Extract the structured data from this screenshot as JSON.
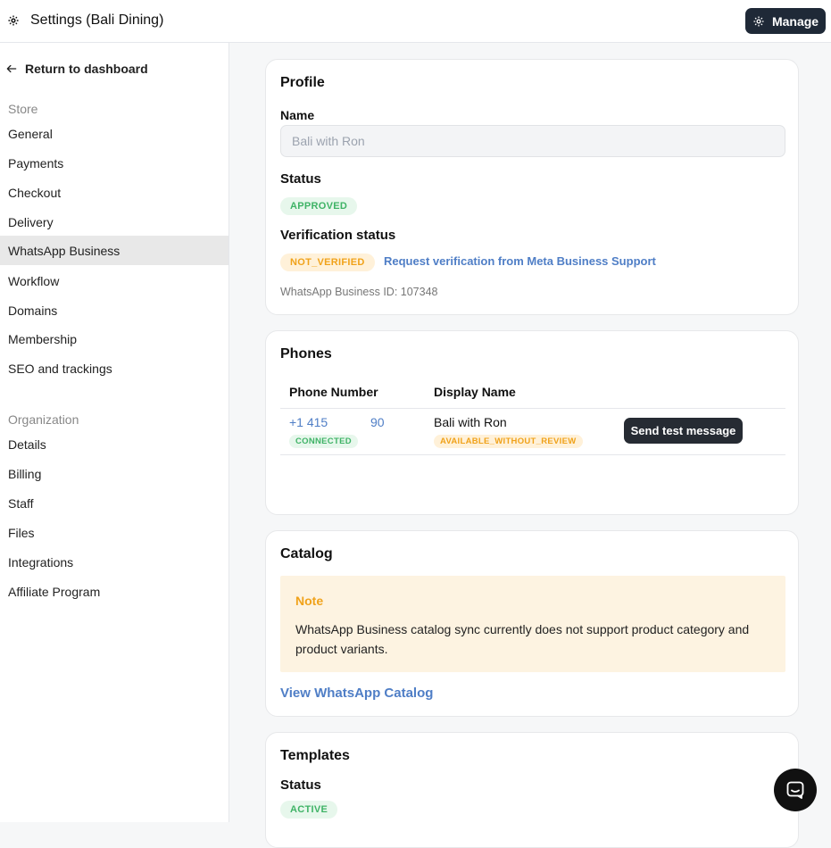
{
  "header": {
    "title": "Settings (Bali Dining)",
    "manage_label": "Manage"
  },
  "sidebar": {
    "return_label": "Return to dashboard",
    "store_label": "Store",
    "store_items": [
      "General",
      "Payments",
      "Checkout",
      "Delivery",
      "WhatsApp Business",
      "Workflow",
      "Domains",
      "Membership",
      "SEO and trackings"
    ],
    "active_item": "WhatsApp Business",
    "org_label": "Organization",
    "org_items": [
      "Details",
      "Billing",
      "Staff",
      "Files",
      "Integrations",
      "Affiliate Program"
    ]
  },
  "profile": {
    "title": "Profile",
    "name_label": "Name",
    "name_value": "Bali with Ron",
    "status_label": "Status",
    "status_badge": "APPROVED",
    "verification_label": "Verification status",
    "verification_badge": "NOT_VERIFIED",
    "verification_link": "Request verification from Meta Business Support",
    "business_id_text": "WhatsApp Business ID: 107348"
  },
  "phones": {
    "title": "Phones",
    "col_phone": "Phone Number",
    "col_display": "Display Name",
    "rows": [
      {
        "phone_prefix": "+1 415",
        "phone_suffix": "90",
        "phone_status": "CONNECTED",
        "display_name": "Bali with Ron",
        "display_status": "AVAILABLE_WITHOUT_REVIEW",
        "action_label": "Send test message"
      }
    ]
  },
  "catalog": {
    "title": "Catalog",
    "note_title": "Note",
    "note_text": "WhatsApp Business catalog sync currently does not support product category and product variants.",
    "link_label": "View WhatsApp Catalog"
  },
  "templates": {
    "title": "Templates",
    "status_label": "Status",
    "status_badge": "ACTIVE"
  },
  "colors": {
    "accent_link": "#4f7ec6",
    "success": "#3fb366",
    "warning": "#f0a21a",
    "dark_button": "#1f2937"
  }
}
